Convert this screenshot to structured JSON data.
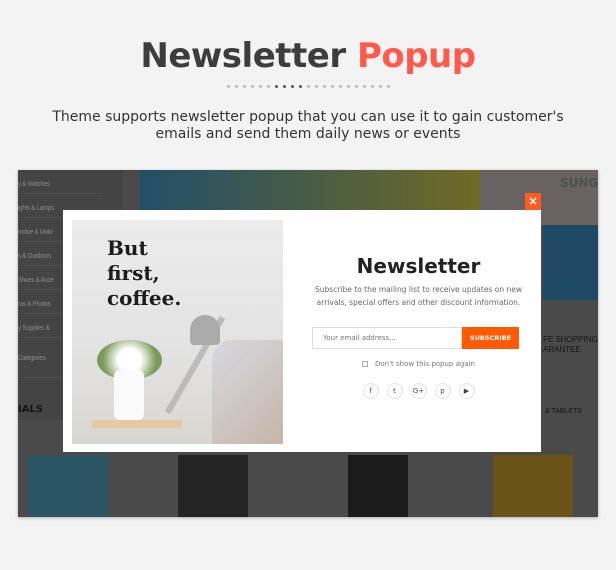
{
  "header": {
    "title_main": "Newsletter",
    "title_accent": "Popup",
    "subtitle": "Theme supports newsletter popup that you can use it to gain customer's emails and send them daily news or events"
  },
  "colors": {
    "accent": "#ff5a4c",
    "button": "#ff5a00"
  },
  "background": {
    "sidebar_items": [
      "y & Watches",
      "ights & Lamps",
      "notive & Moto",
      "s & Outdoors",
      "Shoes & Acce",
      "ras & Photos",
      "y Supplies &",
      "Categories"
    ],
    "deals": "IALS",
    "banner_text": "SUNGL",
    "safe_shopping": [
      "FE SHOPPING",
      "ARANTEE"
    ],
    "tablets": "& TABLETS"
  },
  "popup": {
    "image_quote": [
      "But",
      "first,",
      "coffee."
    ],
    "title": "Newsletter",
    "description": "Subscribe to the mailing list to receive updates on new arrivals, special offers and other discount information.",
    "email_placeholder": "Your email address...",
    "subscribe_label": "SUBSCRIBE",
    "dont_show_label": "Don't show this popup again",
    "close_label": "×",
    "social": [
      {
        "icon": "facebook-icon",
        "glyph": "f"
      },
      {
        "icon": "twitter-icon",
        "glyph": "t"
      },
      {
        "icon": "google-plus-icon",
        "glyph": "G+"
      },
      {
        "icon": "pinterest-icon",
        "glyph": "p"
      },
      {
        "icon": "youtube-icon",
        "glyph": "▶"
      }
    ]
  }
}
